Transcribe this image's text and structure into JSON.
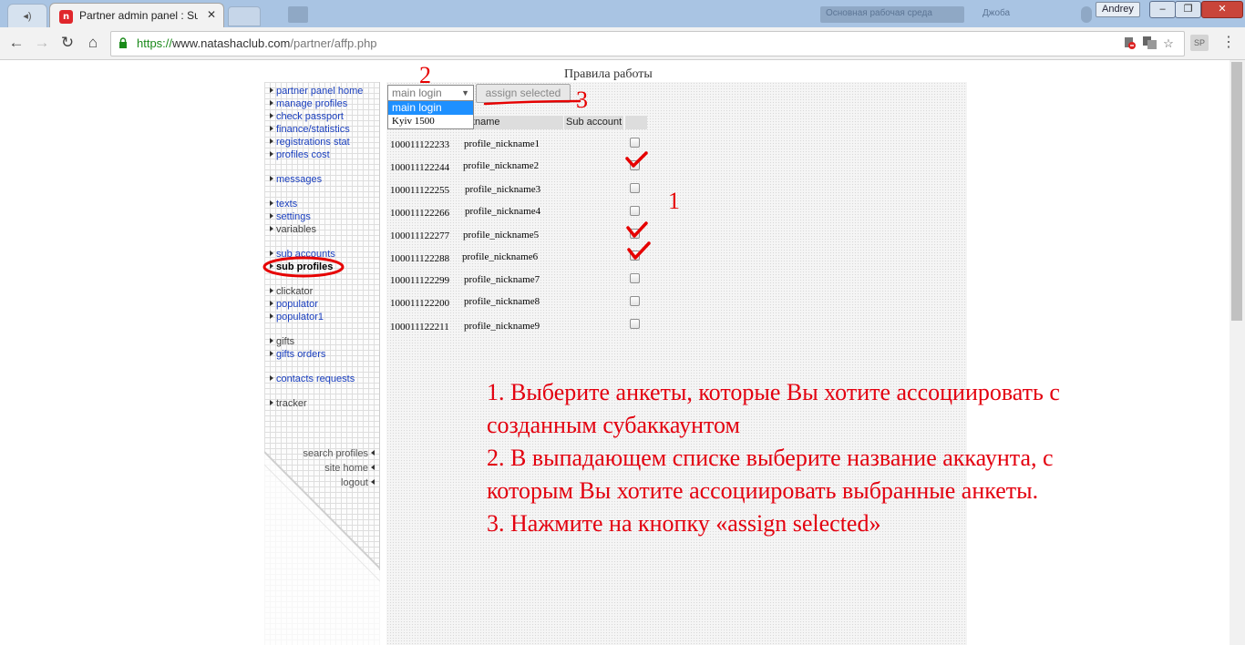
{
  "browser": {
    "tab_title": "Partner admin panel : Sub",
    "tab_close": "✕",
    "favicon_letter": "n",
    "user": "Andrey",
    "url_https": "https://",
    "url_host": "www.natashaclub.com",
    "url_path": "/partner/affp.php",
    "ext_label": "SP",
    "bg_bar_label1": "Основная рабочая среда",
    "bg_bar_label2": "Джоба"
  },
  "colors": {
    "link": "#1a3fbf",
    "annotation_red": "#e3000f",
    "dropdown_highlight": "#1e90ff"
  },
  "page": {
    "header": "Правила работы"
  },
  "sidebar": {
    "items": [
      {
        "label": "partner panel home"
      },
      {
        "label": "manage profiles"
      },
      {
        "label": "check passport"
      },
      {
        "label": "finance/statistics"
      },
      {
        "label": "registrations stat"
      },
      {
        "label": "profiles cost"
      },
      {
        "label": "messages"
      },
      {
        "label": "texts"
      },
      {
        "label": "settings"
      },
      {
        "label": "variables"
      },
      {
        "label": "sub accounts"
      },
      {
        "label": "sub profiles"
      },
      {
        "label": "clickator"
      },
      {
        "label": "populator"
      },
      {
        "label": "populator1"
      },
      {
        "label": "gifts"
      },
      {
        "label": "gifts orders"
      },
      {
        "label": "contacts requests"
      },
      {
        "label": "tracker"
      }
    ],
    "bottom_links": [
      {
        "label": "search profiles"
      },
      {
        "label": "site home"
      },
      {
        "label": "logout"
      }
    ]
  },
  "controls": {
    "select_value": "main login",
    "options": [
      "main login",
      "Kyiv 1500"
    ],
    "assign_button": "assign selected"
  },
  "table": {
    "headers": {
      "nickname": "ckname",
      "sub_account": "Sub account"
    },
    "rows": [
      {
        "id": "100011122233",
        "nickname": "profile_nickname1",
        "checked": false
      },
      {
        "id": "100011122244",
        "nickname": "profile_nickname2",
        "checked": true
      },
      {
        "id": "100011122255",
        "nickname": "profile_nickname3",
        "checked": false
      },
      {
        "id": "100011122266",
        "nickname": "profile_nickname4",
        "checked": false
      },
      {
        "id": "100011122277",
        "nickname": "profile_nickname5",
        "checked": true
      },
      {
        "id": "100011122288",
        "nickname": "profile_nickname6",
        "checked": true
      },
      {
        "id": "100011122299",
        "nickname": "profile_nickname7",
        "checked": false
      },
      {
        "id": "100011122200",
        "nickname": "profile_nickname8",
        "checked": false
      },
      {
        "id": "100011122211",
        "nickname": "profile_nickname9",
        "checked": false
      }
    ]
  },
  "annotations": {
    "num1": "1",
    "num2": "2",
    "num3": "3",
    "instructions": [
      "1. Выберите анкеты, которые Вы хотите ассоциировать с",
      "созданным субаккаунтом",
      "2.  В выпадающем списке выберите название аккаунта, с",
      "которым Вы хотите ассоциировать выбранные анкеты.",
      "3. Нажмите на кнопку «assign selected»"
    ]
  }
}
